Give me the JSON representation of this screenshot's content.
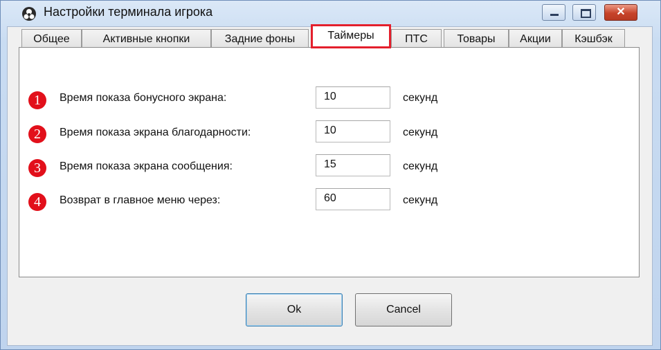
{
  "window": {
    "title": "Настройки терминала игрока",
    "icons": {
      "app": "app-logo-icon",
      "minimize": "minimize-icon",
      "maximize": "maximize-icon",
      "close": "close-icon"
    },
    "close_glyph": "✕"
  },
  "tabs": [
    {
      "label": "Общее"
    },
    {
      "label": "Активные кнопки"
    },
    {
      "label": "Задние фоны"
    },
    {
      "label": "Таймеры"
    },
    {
      "label": "ПТС"
    },
    {
      "label": "Товары"
    },
    {
      "label": "Акции"
    },
    {
      "label": "Кэшбэк"
    }
  ],
  "active_tab": "Таймеры",
  "timers": [
    {
      "badge": "1",
      "label": "Время показа бонусного экрана:",
      "value": "10",
      "unit": "секунд"
    },
    {
      "badge": "2",
      "label": "Время показа экрана благодарности:",
      "value": "10",
      "unit": "секунд"
    },
    {
      "badge": "3",
      "label": "Время показа экрана сообщения:",
      "value": "15",
      "unit": "секунд"
    },
    {
      "badge": "4",
      "label": "Возврат в главное меню через:",
      "value": "60",
      "unit": "секунд"
    }
  ],
  "buttons": {
    "ok": "Ok",
    "cancel": "Cancel"
  },
  "colors": {
    "highlight": "#e41f2c",
    "badge": "#e2101b",
    "close_button": "#c7432a"
  }
}
